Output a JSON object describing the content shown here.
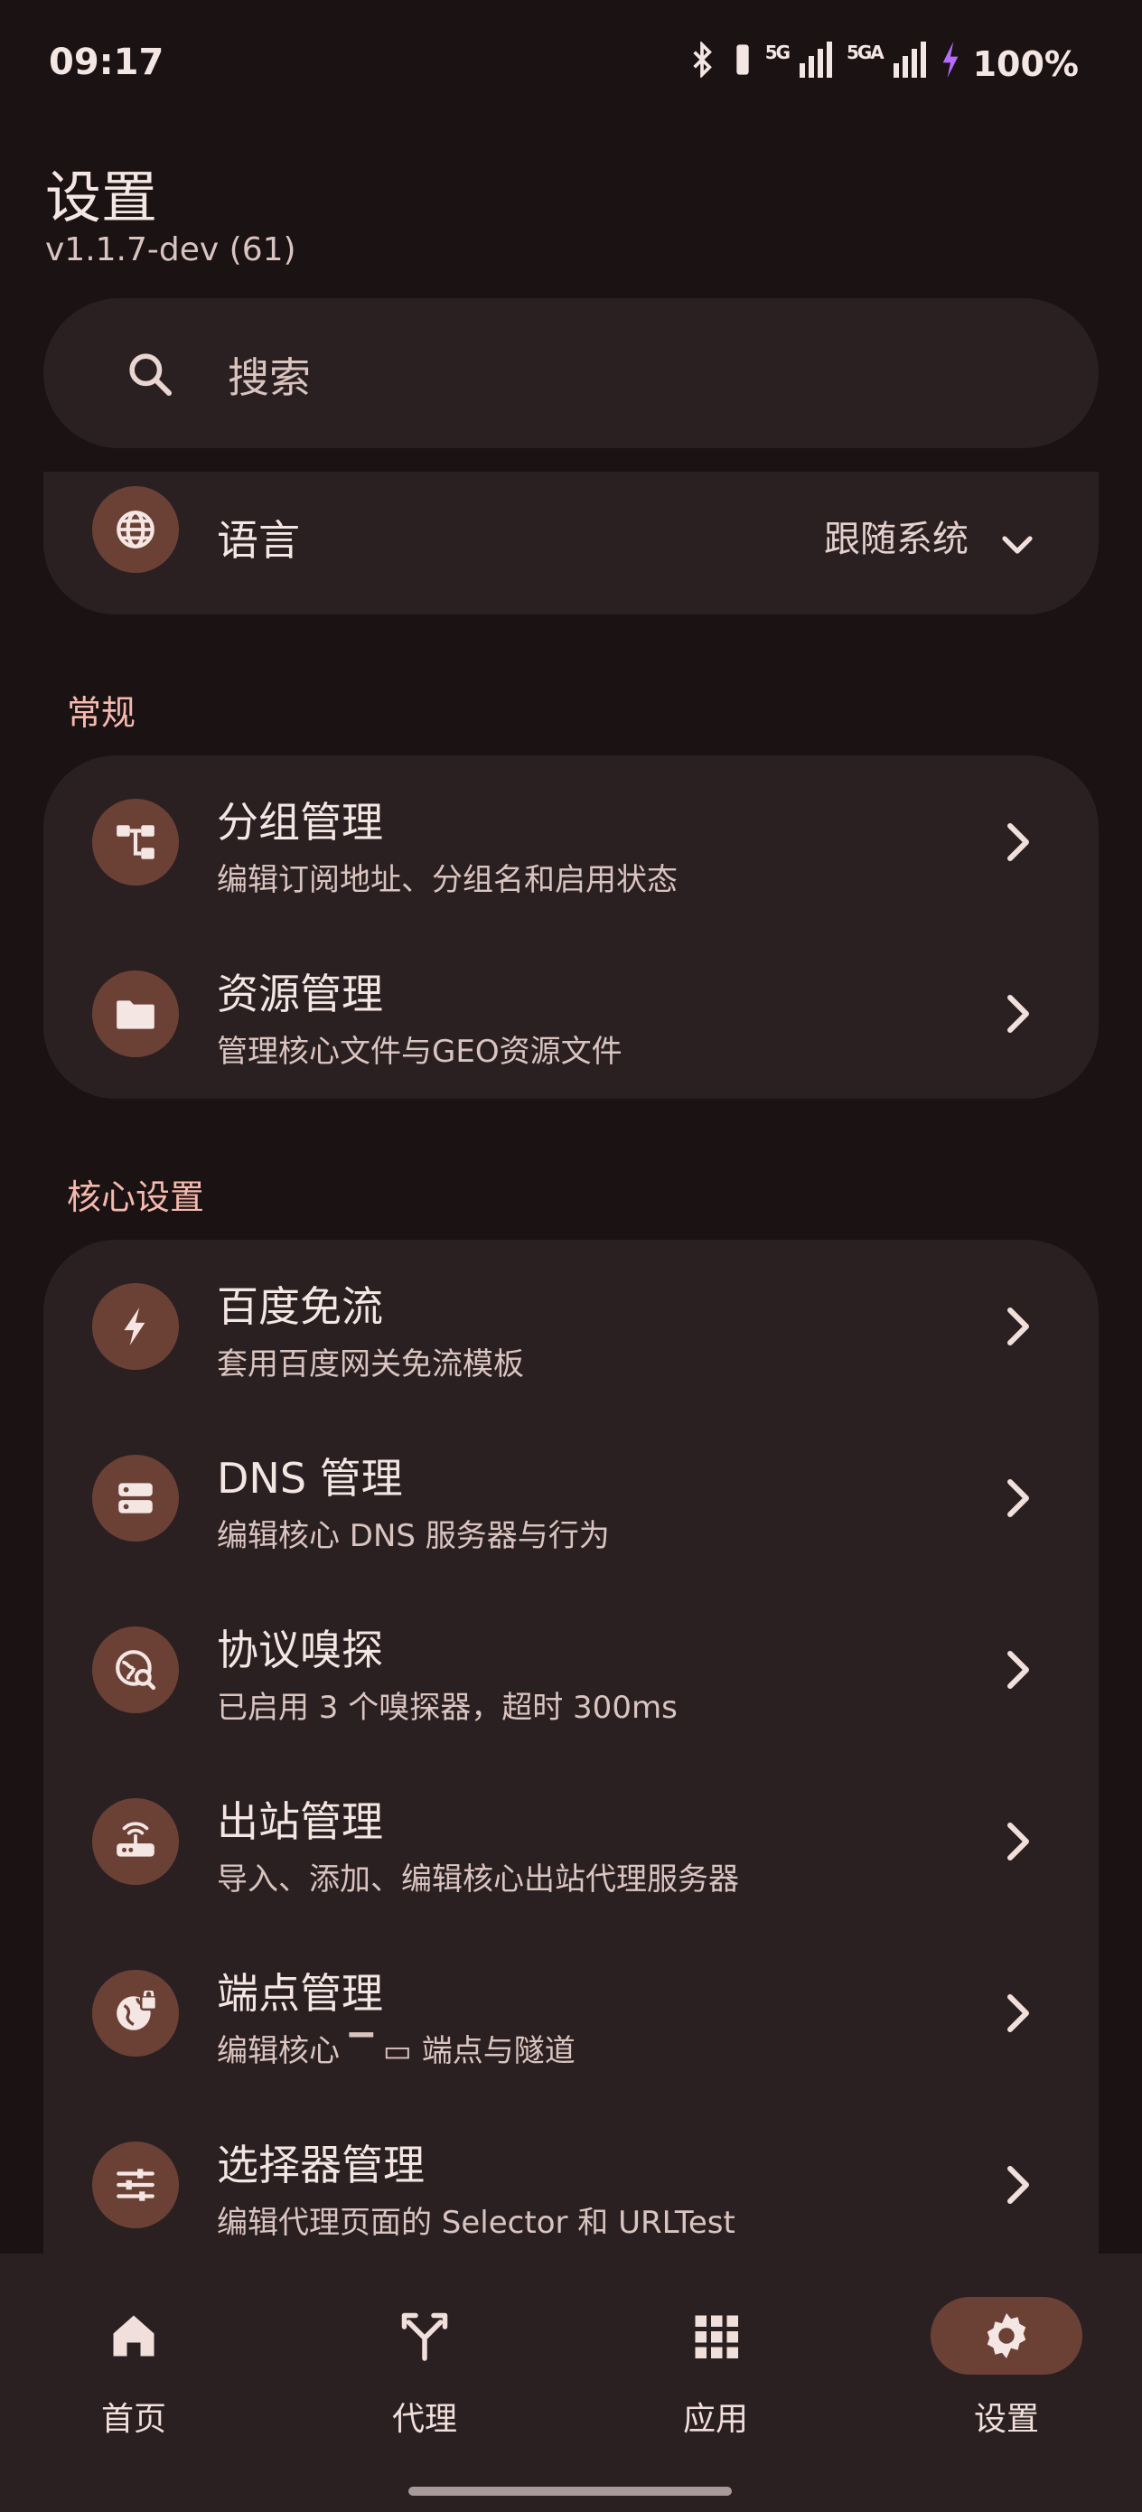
{
  "status_bar": {
    "time": "09:17",
    "signal1": "5G",
    "signal2": "5GA",
    "battery": "100%"
  },
  "header": {
    "title": "设置",
    "version": "v1.1.7-dev (61)"
  },
  "search": {
    "placeholder": "搜索"
  },
  "language": {
    "label": "语言",
    "value": "跟随系统"
  },
  "sections": {
    "general": {
      "label": "常规",
      "items": [
        {
          "title": "分组管理",
          "subtitle": "编辑订阅地址、分组名和启用状态",
          "icon": "group-tree-icon"
        },
        {
          "title": "资源管理",
          "subtitle": "管理核心文件与GEO资源文件",
          "icon": "folder-icon"
        }
      ]
    },
    "core": {
      "label": "核心设置",
      "items": [
        {
          "title": "百度免流",
          "subtitle": "套用百度网关免流模板",
          "icon": "bolt-icon"
        },
        {
          "title": "DNS 管理",
          "subtitle": "编辑核心 DNS 服务器与行为",
          "icon": "dns-icon"
        },
        {
          "title": "协议嗅探",
          "subtitle": "已启用 3 个嗅探器，超时 300ms",
          "icon": "globe-search-icon"
        },
        {
          "title": "出站管理",
          "subtitle": "导入、添加、编辑核心出站代理服务器",
          "icon": "router-icon"
        },
        {
          "title": "端点管理",
          "subtitle": "编辑核心 ▔ ▭ 端点与隧道",
          "icon": "globe-lock-icon"
        },
        {
          "title": "选择器管理",
          "subtitle": "编辑代理页面的 Selector 和 URLTest",
          "icon": "sliders-icon"
        }
      ]
    }
  },
  "nav": {
    "items": [
      {
        "label": "首页",
        "icon": "home-icon"
      },
      {
        "label": "代理",
        "icon": "fork-icon"
      },
      {
        "label": "应用",
        "icon": "apps-grid-icon"
      },
      {
        "label": "设置",
        "icon": "gear-icon",
        "active": true
      }
    ]
  },
  "colors": {
    "background": "#1b1213",
    "card": "#2b2021",
    "accent_bubble": "#6b4136",
    "section_label": "#f6b9ad",
    "battery_bolt": "#b56cff"
  }
}
